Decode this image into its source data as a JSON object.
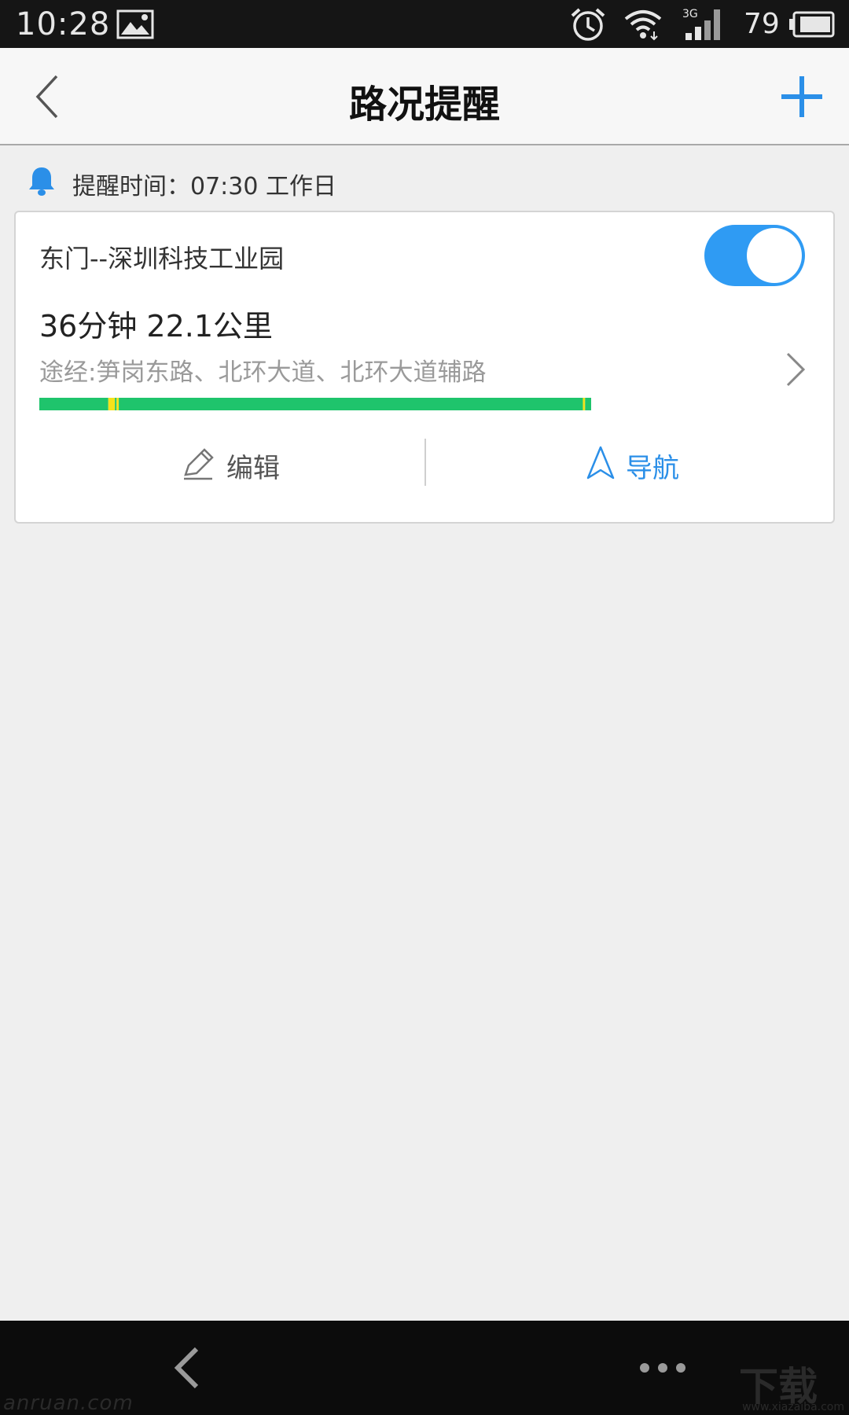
{
  "status_bar": {
    "time": "10:28",
    "battery_level": "79",
    "icons": [
      "image-icon",
      "alarm-icon",
      "wifi-icon",
      "signal-3g-icon",
      "battery-icon"
    ],
    "network_label": "3G"
  },
  "header": {
    "title": "路况提醒",
    "back_icon": "chevron-left-icon",
    "add_icon": "plus-icon"
  },
  "reminder": {
    "text": "提醒时间：07:30 工作日",
    "icon": "bell-icon"
  },
  "route_card": {
    "route_name": "东门--深圳科技工业园",
    "enabled": true,
    "summary": "36分钟 22.1公里",
    "via": "途经:笋岗东路、北环大道、北环大道辅路",
    "traffic_segments": [
      {
        "status": "smooth",
        "color": "#1fc46c",
        "fraction": 0.125
      },
      {
        "status": "slow",
        "color": "#f5e21a",
        "fraction": 0.012
      },
      {
        "status": "smooth",
        "color": "#1fc46c",
        "fraction": 0.003
      },
      {
        "status": "slow",
        "color": "#f5e21a",
        "fraction": 0.004
      },
      {
        "status": "smooth",
        "color": "#1fc46c",
        "fraction": 0.841
      },
      {
        "status": "slow",
        "color": "#f5e21a",
        "fraction": 0.004
      },
      {
        "status": "smooth",
        "color": "#1fc46c",
        "fraction": 0.011
      }
    ],
    "actions": {
      "edit_label": "编辑",
      "navigate_label": "导航"
    }
  },
  "colors": {
    "accent": "#2b8fe8",
    "toggle_on": "#2f9bf3",
    "smooth": "#1fc46c",
    "slow": "#f5e21a"
  },
  "watermark": {
    "left": "anruan.com",
    "right_title": "下载吧",
    "right_sub": "www.xiazaiba.com"
  }
}
